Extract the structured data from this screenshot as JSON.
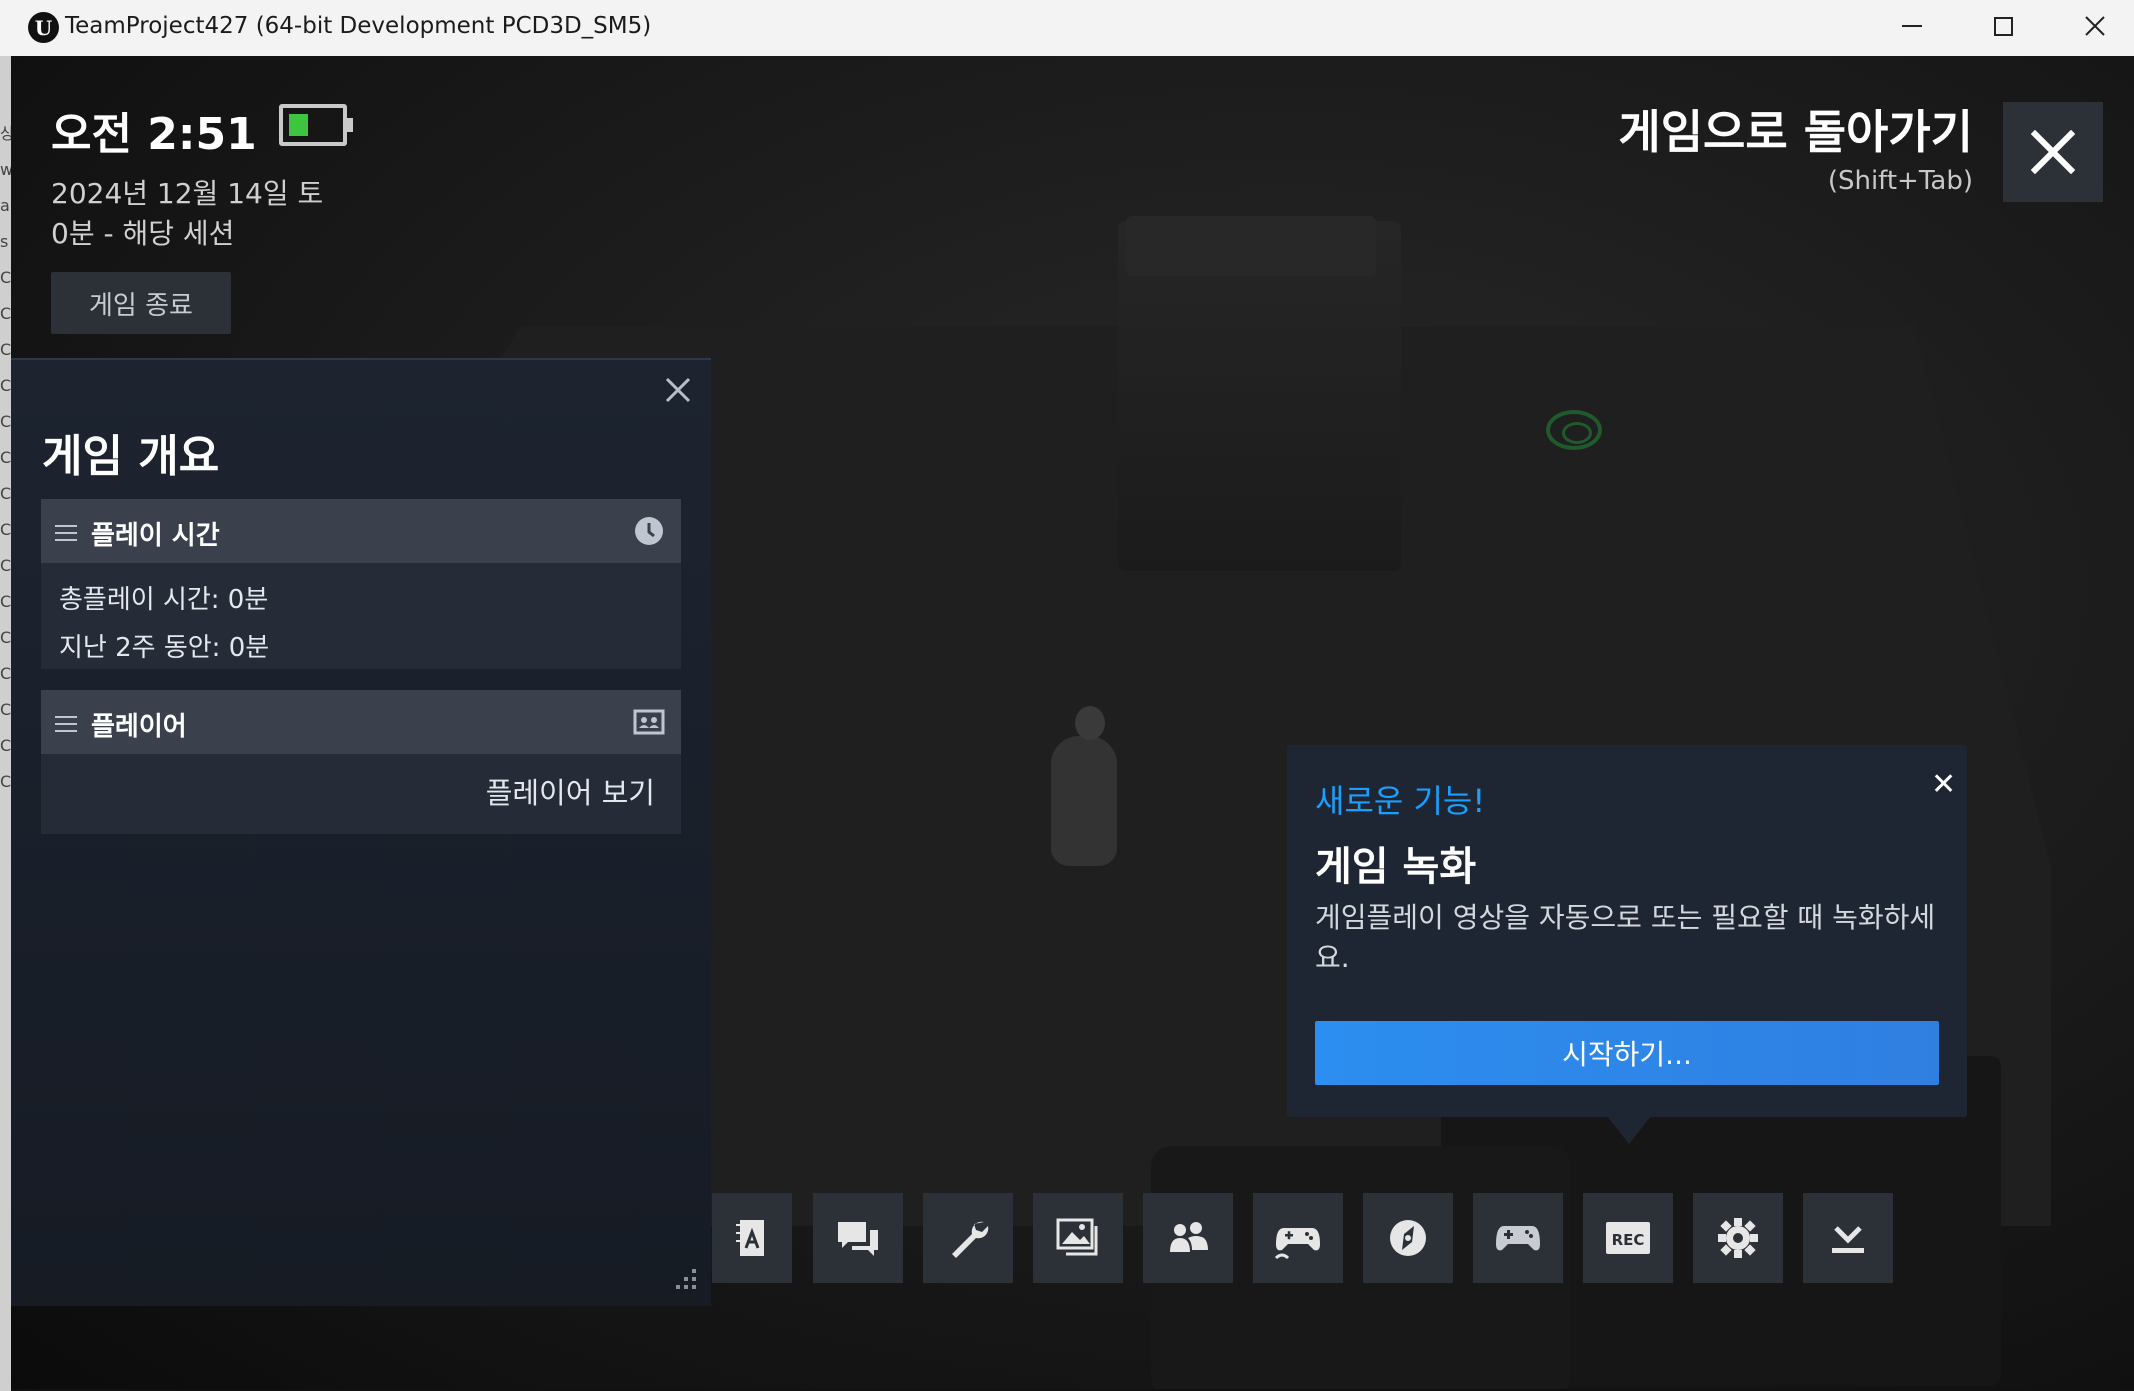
{
  "window": {
    "title": "TeamProject427 (64-bit Development PCD3D_SM5)",
    "logo_letter": "U",
    "controls": [
      "minimize",
      "maximize",
      "close"
    ]
  },
  "gutter_letters": "상 w a s C C C C C C C C C C C C C C C",
  "overlay": {
    "clock": "오전 2:51",
    "battery_level": 0.35,
    "date": "2024년 12월 14일 토",
    "session": "0분 - 해당 세션",
    "quit_label": "게임 종료",
    "return_label": "게임으로 돌아가기",
    "return_hint": "(Shift+Tab)"
  },
  "panel": {
    "title": "게임 개요",
    "playtime": {
      "title": "플레이 시간",
      "total": "총플레이 시간: 0분",
      "recent": "지난 2주 동안: 0분"
    },
    "players": {
      "title": "플레이어",
      "link": "플레이어 보기"
    }
  },
  "popup": {
    "kicker": "새로운 기능!",
    "title": "게임 녹화",
    "body": "게임플레이 영상을 자동으로 또는 필요할 때 녹화하세요.",
    "cta": "시작하기...",
    "close_glyph": "✕"
  },
  "toolbar": {
    "items": [
      "guides-icon",
      "chat-icon",
      "wrench-icon",
      "screenshot-icon",
      "friends-icon",
      "controller-config-icon",
      "compass-icon",
      "gamepad-icon",
      "rec-icon",
      "settings-icon",
      "download-icon"
    ],
    "rec_label": "REC"
  },
  "colors": {
    "accent": "#1a9fff",
    "cta": "#2c8ef0",
    "battery": "#3ec43e",
    "button_bg": "#2c3138"
  }
}
